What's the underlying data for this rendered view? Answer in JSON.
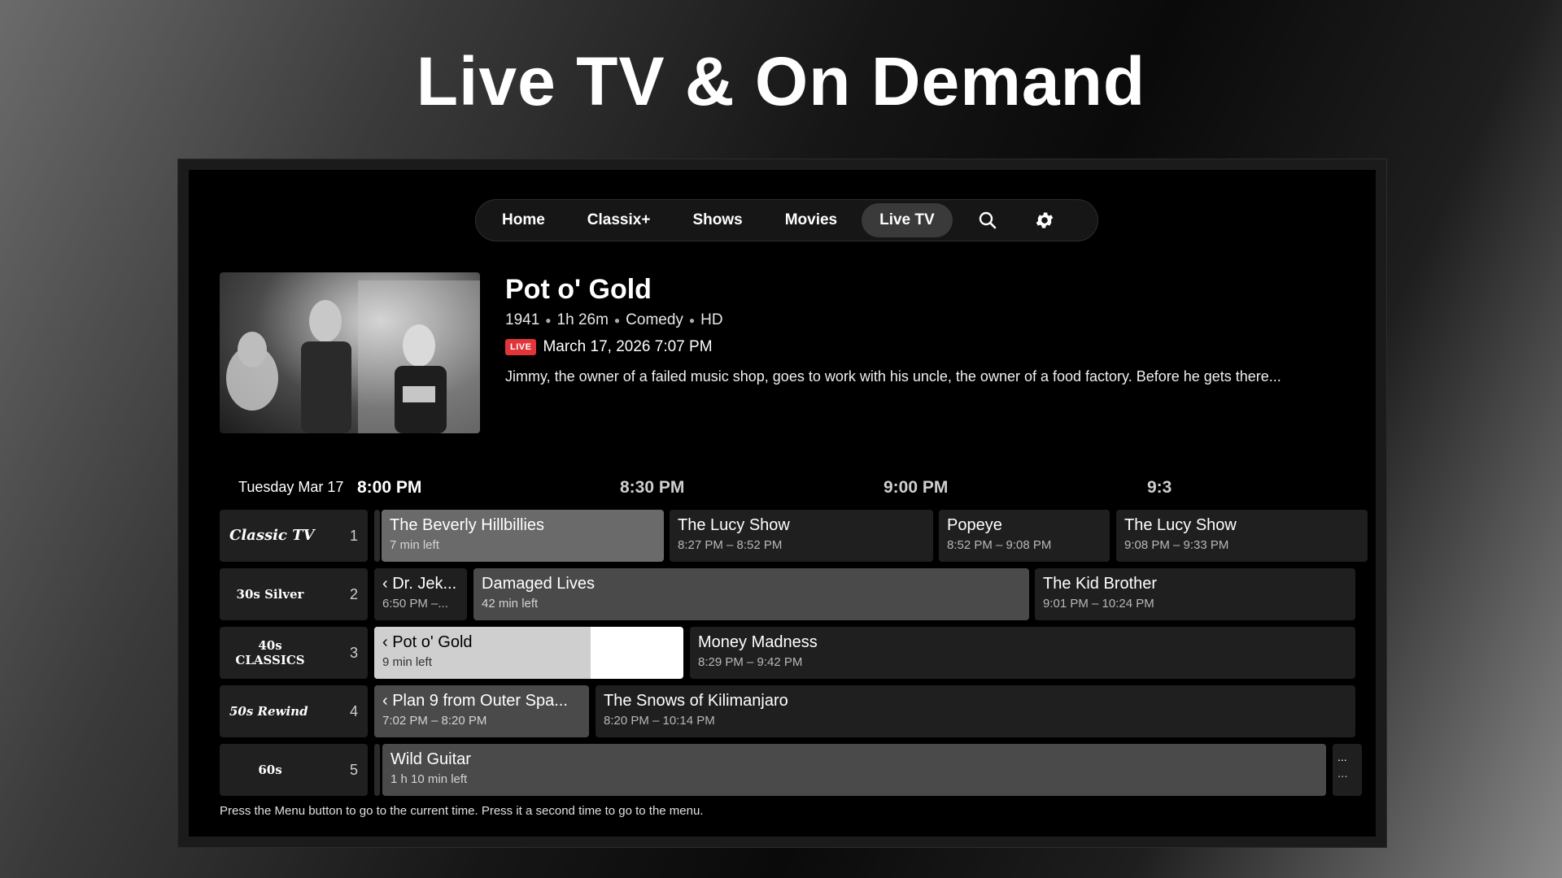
{
  "headline": "Live TV & On Demand",
  "nav": {
    "items": [
      {
        "label": "Home",
        "active": false
      },
      {
        "label": "Classix+",
        "active": false
      },
      {
        "label": "Shows",
        "active": false
      },
      {
        "label": "Movies",
        "active": false
      },
      {
        "label": "Live TV",
        "active": true
      }
    ],
    "search_icon": "search-icon",
    "settings_icon": "gear-icon"
  },
  "hero": {
    "title": "Pot o' Gold",
    "year": "1941",
    "duration": "1h 26m",
    "genre": "Comedy",
    "quality": "HD",
    "live_badge": "LIVE",
    "live_badge_color": "#e2353a",
    "air_datetime": "March 17, 2026 7:07 PM",
    "description": "Jimmy, the owner of a failed music shop, goes to work with his uncle, the owner of a food factory. Before he gets there..."
  },
  "guide": {
    "date": "Tuesday Mar 17",
    "times": [
      "8:00 PM",
      "8:30 PM",
      "9:00 PM",
      "9:3"
    ],
    "channels": [
      {
        "logo": "Classic TV",
        "number": "1"
      },
      {
        "logo": "30s Silver",
        "number": "2"
      },
      {
        "logo": "40s CLASSICS",
        "number": "3"
      },
      {
        "logo": "50s Rewind",
        "number": "4"
      },
      {
        "logo": "60s",
        "number": "5"
      }
    ],
    "rows": [
      [
        {
          "title": "The Beverly Hillbillies",
          "sub": "7 min left"
        },
        {
          "title": "The Lucy Show",
          "sub": "8:27 PM – 8:52 PM"
        },
        {
          "title": "Popeye",
          "sub": "8:52 PM – 9:08 PM"
        },
        {
          "title": "The Lucy Show",
          "sub": "9:08 PM – 9:33 PM"
        }
      ],
      [
        {
          "title": "‹ Dr. Jek...",
          "sub": "6:50 PM –..."
        },
        {
          "title": "Damaged Lives",
          "sub": "42 min left"
        },
        {
          "title": "The Kid Brother",
          "sub": "9:01 PM – 10:24 PM"
        }
      ],
      [
        {
          "title": "‹ Pot o' Gold",
          "sub": "9 min left",
          "progress": 0.7
        },
        {
          "title": "Money Madness",
          "sub": "8:29 PM – 9:42 PM"
        }
      ],
      [
        {
          "title": "‹ Plan 9 from Outer Spa...",
          "sub": "7:02 PM – 8:20 PM"
        },
        {
          "title": "The Snows of Kilimanjaro",
          "sub": "8:20 PM – 10:14 PM"
        }
      ],
      [
        {
          "title": "Wild Guitar",
          "sub": "1 h 10 min left"
        },
        {
          "title": "...",
          "sub": "..."
        }
      ]
    ]
  },
  "hint": "Press the Menu button to go to the current time. Press it a second time to go to the menu."
}
